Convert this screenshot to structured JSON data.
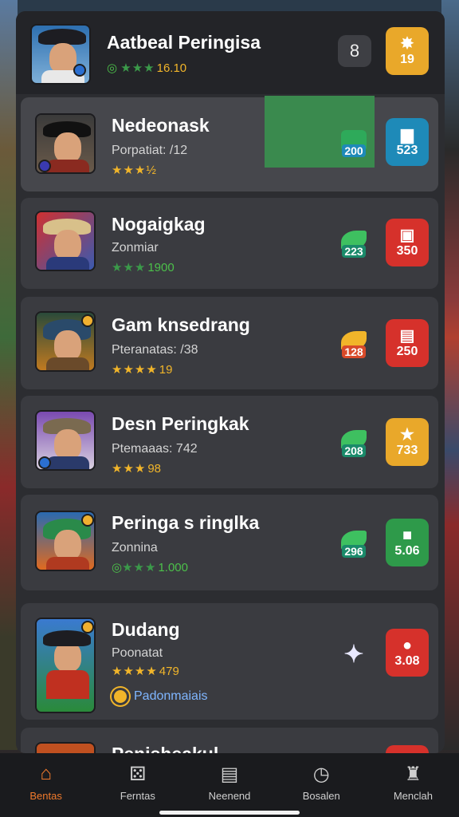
{
  "header": {
    "title": "Aatbeal Peringisa",
    "rating_value": "16.10",
    "counter": "8",
    "badge_value": "19"
  },
  "games": [
    {
      "title": "Nedeonask",
      "subtitle": "Porpatiat: /12",
      "stars": "★★★½",
      "rating": "",
      "mini_value": "200",
      "badge_value": "523",
      "badge_color": "#1e8ab8"
    },
    {
      "title": "Nogaigkag",
      "subtitle": "Zonmiar",
      "stars": "★★★",
      "rating": "1900",
      "mini_value": "223",
      "badge_value": "350",
      "badge_color": "#d6312b"
    },
    {
      "title": "Gam knsedrang",
      "subtitle": "Pteranatas: /38",
      "stars": "★★★★",
      "rating": "19",
      "mini_value": "128",
      "badge_value": "250",
      "badge_color": "#d6312b"
    },
    {
      "title": "Desn Peringkak",
      "subtitle": "Ptemaaas: 742",
      "stars": "★★★",
      "rating": "98",
      "mini_value": "208",
      "badge_value": "733",
      "badge_color": "#e9a82a"
    },
    {
      "title": "Peringa s ringlka",
      "subtitle": "Zonnina",
      "stars": "★★★",
      "rating": "1.000",
      "mini_value": "296",
      "badge_value": "5.06",
      "badge_color": "#2e9a4a"
    },
    {
      "title": "Dudang",
      "subtitle": "Poonatat",
      "stars": "★★★★",
      "rating": "479",
      "mini_value": "",
      "badge_value": "3.08",
      "badge_color": "#d6312b",
      "link": "Padonmaiais"
    },
    {
      "title": "Penisheakul",
      "subtitle": "",
      "stars": "",
      "rating": "",
      "mini_value": "",
      "badge_value": "",
      "badge_color": "#d6312b"
    }
  ],
  "tabs": [
    {
      "label": "Bentas",
      "icon": "home-icon"
    },
    {
      "label": "Ferntas",
      "icon": "games-icon"
    },
    {
      "label": "Neenend",
      "icon": "list-icon"
    },
    {
      "label": "Bosalen",
      "icon": "clock-icon"
    },
    {
      "label": "Menclah",
      "icon": "trophy-icon"
    }
  ],
  "colors": {
    "accent": "#f07a2c",
    "star": "#f1b52a",
    "panel": "#2c2d31",
    "card": "#3a3b40"
  }
}
